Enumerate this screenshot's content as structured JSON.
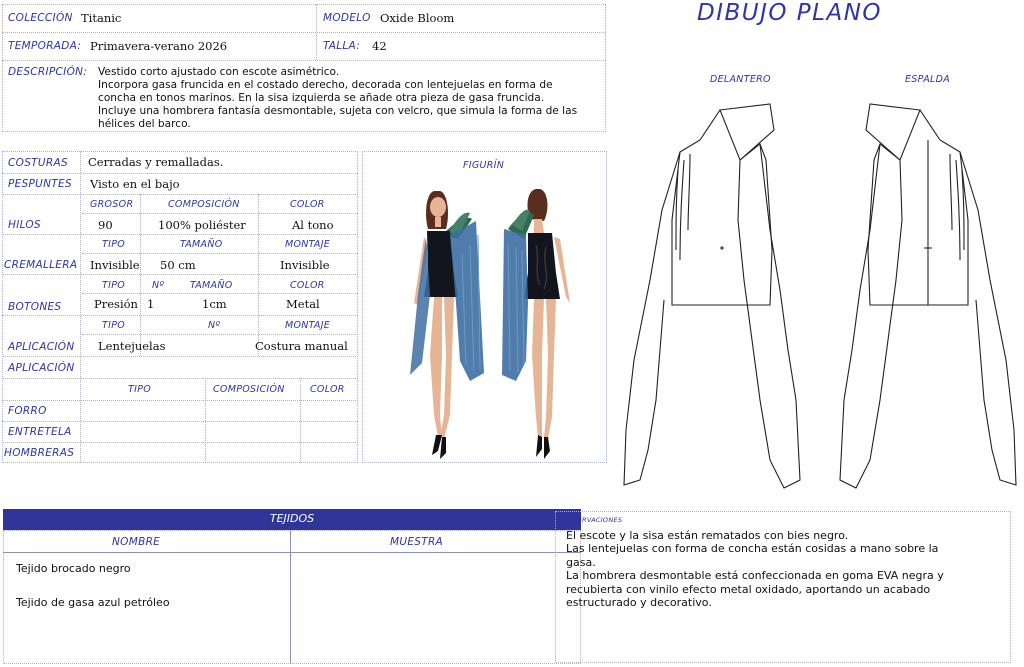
{
  "header": {
    "coleccion": {
      "label": "COLECCIÓN",
      "value": "Titanic"
    },
    "modelo": {
      "label": "MODELO",
      "value": "Oxide Bloom"
    },
    "temporada": {
      "label": "TEMPORADA:",
      "value": "Primavera-verano 2026"
    },
    "talla": {
      "label": "TALLA:",
      "value": "42"
    },
    "descripcion": {
      "label": "DESCRIPCIÓN:",
      "lines": [
        "Vestido corto ajustado con escote asimétrico.",
        "Incorpora gasa fruncida en el costado derecho, decorada con lentejuelas en forma de",
        "concha en tonos marinos. En la sisa izquierda se añade otra pieza de gasa fruncida.",
        "Incluye una hombrera fantasía desmontable, sujeta con velcro, que simula la forma de las",
        "hélices del barco."
      ]
    }
  },
  "specs": {
    "costuras": {
      "label": "COSTURAS",
      "value": "Cerradas y remalladas."
    },
    "pespuntes": {
      "label": "PESPUNTES",
      "value": "Visto en el bajo"
    },
    "hilos": {
      "label": "HILOS",
      "headers": [
        "GROSOR",
        "COMPOSICIÓN",
        "COLOR"
      ],
      "values": [
        "90",
        "100% poliéster",
        "Al tono"
      ]
    },
    "cremallera": {
      "label": "CREMALLERA",
      "headers": [
        "TIPO",
        "TAMAÑO",
        "MONTAJE"
      ],
      "values": [
        "Invisible",
        "50 cm",
        "Invisible"
      ]
    },
    "botones": {
      "label": "BOTONES",
      "headers": [
        "TIPO",
        "Nº",
        "TAMAÑO",
        "COLOR"
      ],
      "values": [
        "Presión",
        "1",
        "1cm",
        "Metal"
      ]
    },
    "aplicacion": {
      "labels": [
        "APLICACIÓN",
        "APLICACIÓN"
      ],
      "headers": [
        "TIPO",
        "Nº",
        "MONTAJE"
      ],
      "values": [
        "Lentejuelas",
        "",
        "Costura manual"
      ]
    },
    "forros": {
      "headers": [
        "TIPO",
        "COMPOSICIÓN",
        "COLOR"
      ],
      "rows": [
        "FORRO",
        "ENTRETELA",
        "HOMBRERAS"
      ]
    }
  },
  "figurin": {
    "label": "FIGURÍN"
  },
  "dibujo": {
    "title": "DIBUJO PLANO",
    "delantero": "DELANTERO",
    "espalda": "ESPALDA"
  },
  "tejidos": {
    "title": "TEJIDOS",
    "col_nombre": "NOMBRE",
    "col_muestra": "MUESTRA",
    "items": [
      "Tejido brocado negro",
      "Tejido de gasa azul petróleo"
    ]
  },
  "observaciones": {
    "label": "OBSERVACIONES",
    "lines": [
      "El escote y la sisa están rematados con bies negro.",
      "Las lentejuelas con forma de concha están cosidas a mano sobre la",
      "gasa.",
      "La hombrera desmontable está confeccionada en goma EVA negra y",
      "recubierta con vinilo efecto metal oxidado, aportando un acabado",
      "estructurado y decorativo."
    ]
  },
  "colors": {
    "accent": "#2e35a6",
    "banner": "#30359a",
    "gauze": "#3e6fa3",
    "dress": "#14151c"
  }
}
